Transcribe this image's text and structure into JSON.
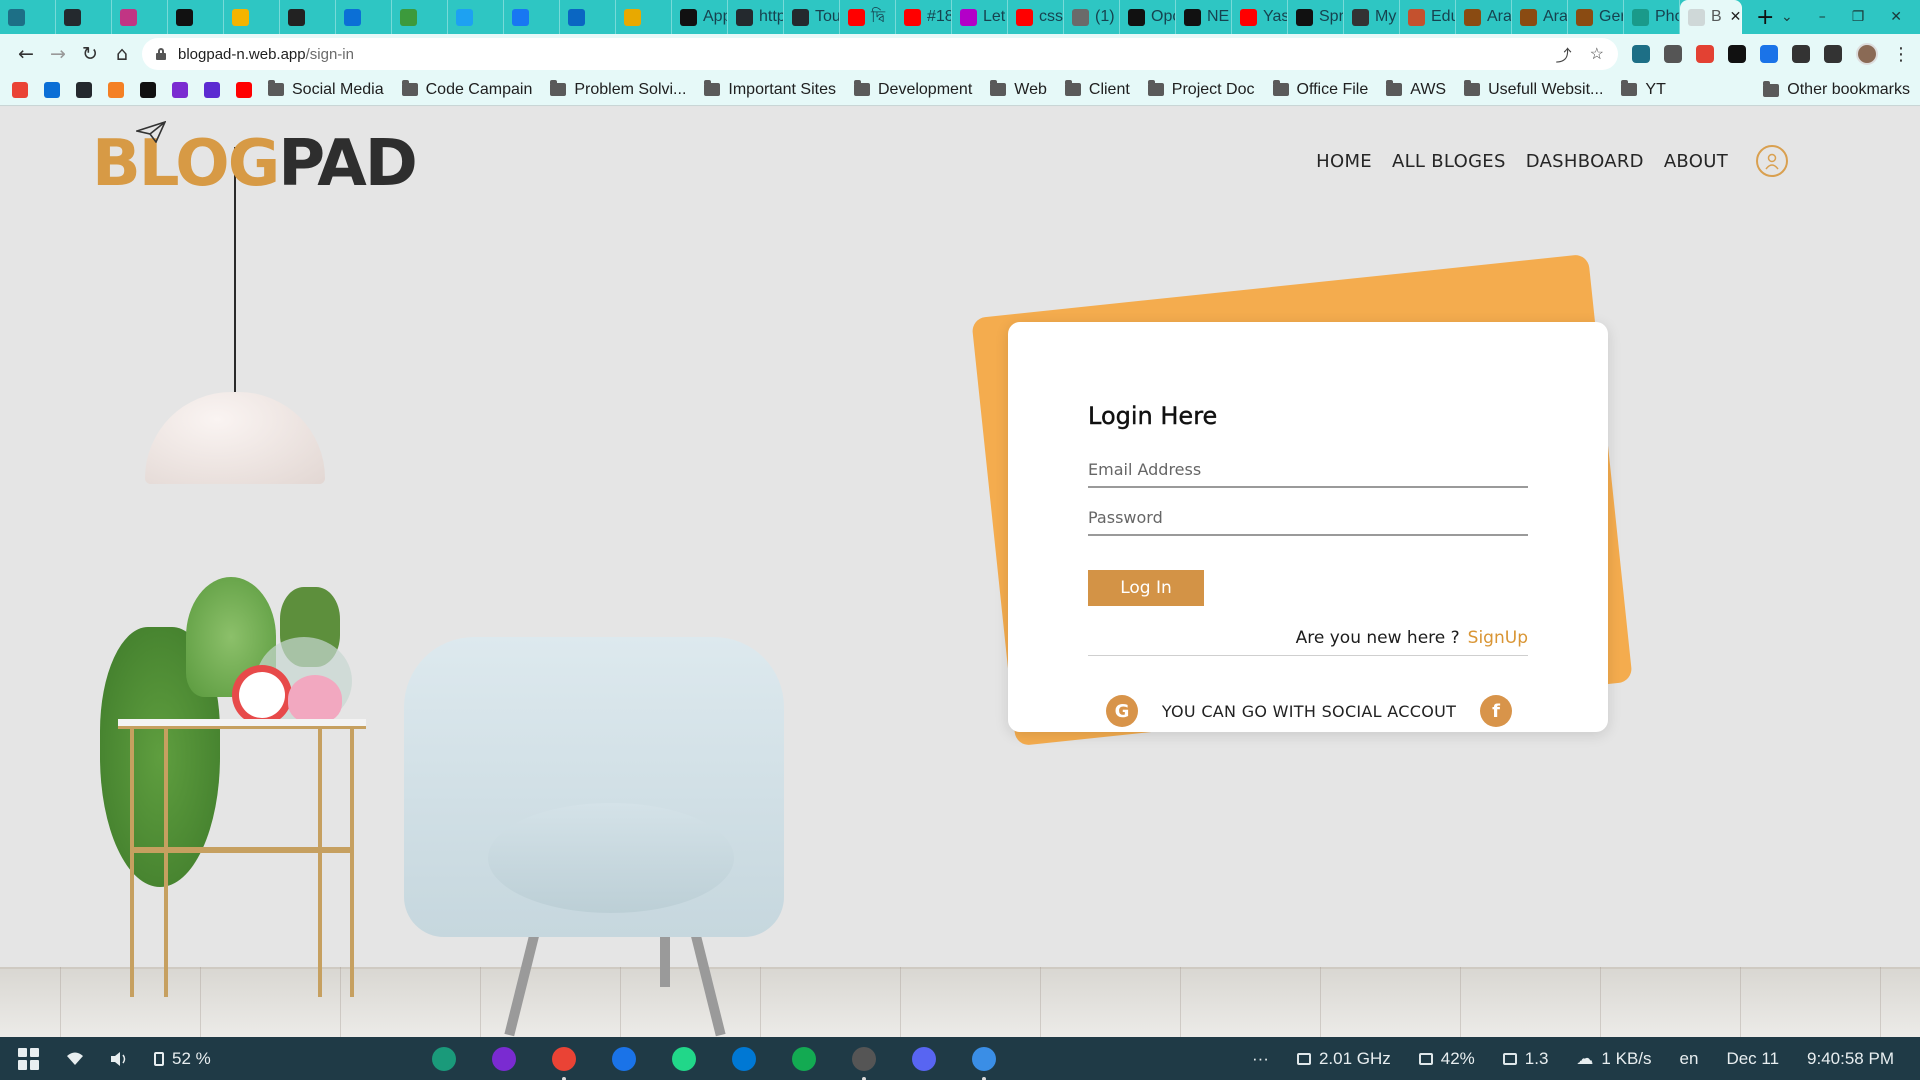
{
  "browser": {
    "tabs": [
      {
        "title": "",
        "color": "#1d6f86"
      },
      {
        "title": "",
        "color": "#24292e"
      },
      {
        "title": "",
        "color": "#c13584"
      },
      {
        "title": "",
        "color": "#111111"
      },
      {
        "title": "",
        "color": "#f4b400"
      },
      {
        "title": "",
        "color": "#222222"
      },
      {
        "title": "",
        "color": "#0b6fd6"
      },
      {
        "title": "",
        "color": "#3c9a3c"
      },
      {
        "title": "",
        "color": "#1da1f2"
      },
      {
        "title": "",
        "color": "#1877f2"
      },
      {
        "title": "",
        "color": "#0a66c2"
      },
      {
        "title": "",
        "color": "#e8a900"
      },
      {
        "title": "App",
        "color": "#111111"
      },
      {
        "title": "http",
        "color": "#24292e"
      },
      {
        "title": "Tou",
        "color": "#24292e"
      },
      {
        "title": "দ্বি",
        "color": "#ff0000"
      },
      {
        "title": "#18",
        "color": "#ff0000"
      },
      {
        "title": "Let",
        "color": "#b300c8"
      },
      {
        "title": "css",
        "color": "#ff0000"
      },
      {
        "title": "(1)",
        "color": "#6a6a6a"
      },
      {
        "title": "Opc",
        "color": "#111111"
      },
      {
        "title": "NE",
        "color": "#111111"
      },
      {
        "title": "Yas",
        "color": "#ff0000"
      },
      {
        "title": "Spr",
        "color": "#111111"
      },
      {
        "title": "My",
        "color": "#333333"
      },
      {
        "title": "Edu",
        "color": "#c4512e"
      },
      {
        "title": "Ara",
        "color": "#8a4b12"
      },
      {
        "title": "Ara",
        "color": "#8a4b12"
      },
      {
        "title": "Ger",
        "color": "#8a4b12"
      },
      {
        "title": "Pho",
        "color": "#1a9a8a"
      }
    ],
    "active_tab": {
      "title": "B",
      "close_label": "✕"
    },
    "new_tab_label": "+",
    "window_controls": {
      "dropdown": "⌄",
      "minimize": "–",
      "restore": "❐",
      "close": "✕"
    },
    "address_bar": {
      "host": "blogpad-n.web.app",
      "path": "/sign-in",
      "share_icon": "⤴",
      "star_icon": "☆"
    },
    "nav": {
      "back": "←",
      "forward": "→",
      "reload": "↻",
      "home": "⌂"
    },
    "extensions": [
      "#1d6f86",
      "#555555",
      "#e34133",
      "#111111",
      "#1a73e8",
      "#333333",
      "#333333"
    ],
    "menu_icon": "⋮",
    "bookmark_icons": [
      "#ea4335",
      "#0b6fd6",
      "#24292e",
      "#f48024",
      "#111111",
      "#7b2bd1",
      "#5b2bd1",
      "#ff0000"
    ],
    "bookmark_folders": [
      "Social Media",
      "Code Campain",
      "Problem Solvi...",
      "Important Sites",
      "Development",
      "Web",
      "Client",
      "Project Doc",
      "Office File",
      "AWS",
      "Usefull Websit...",
      "YT"
    ],
    "other_bookmarks": "Other bookmarks"
  },
  "site": {
    "logo": {
      "part1": "BLOG",
      "part2": "PAD"
    },
    "menu": [
      "HOME",
      "ALL BLOGES",
      "DASHBOARD",
      "ABOUT"
    ],
    "accent": "#d79a45"
  },
  "login": {
    "title": "Login Here",
    "email_placeholder": "Email Address",
    "password_placeholder": "Password",
    "button": "Log In",
    "new_here": "Are you new here ?",
    "signup": "SignUp",
    "social_text": "YOU CAN GO WITH SOCIAL ACCOUT",
    "google_icon": "G",
    "facebook_icon": "f",
    "card_back_color": "#f4ac4e"
  },
  "taskbar": {
    "battery": "52 %",
    "apps": [
      "#1a9a7a",
      "#7a2bd1",
      "#ea4335",
      "#1a73e8",
      "#21d789",
      "#0078d4",
      "#13aa52",
      "#555555",
      "#5865f2",
      "#3a8ee6"
    ],
    "overflow": "···",
    "cpu": "2.01 GHz",
    "memory": "42%",
    "display": "1.3",
    "network": "1 KB/s",
    "lang": "en",
    "date": "Dec 11",
    "time": "9:40:58 PM"
  }
}
